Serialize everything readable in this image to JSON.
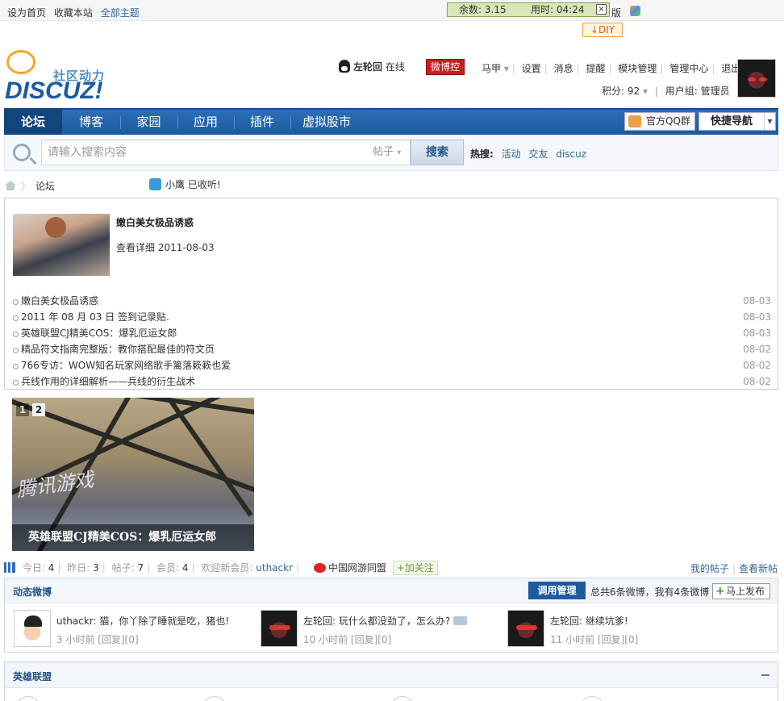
{
  "topbar": {
    "links": [
      "设为首页",
      "收藏本站",
      "全部主题"
    ],
    "remaining_label": "余数:",
    "remaining_value": "3.15",
    "time_label": "用时:",
    "time_value": "04:24",
    "close": "×",
    "version_text": "版"
  },
  "diy": {
    "label": "DIY",
    "arrow": "↓"
  },
  "logo": {
    "slogan": "社区动力",
    "word": "DISCUZ!"
  },
  "user": {
    "name": "左轮回",
    "status": "在线",
    "weibo_btn": "微博控",
    "menu": [
      "马甲",
      "设置",
      "消息",
      "提醒",
      "模块管理",
      "管理中心",
      "退出"
    ],
    "credits_label": "积分:",
    "credits_value": "92",
    "group_label": "用户组:",
    "group_value": "管理员"
  },
  "nav": {
    "tabs": [
      "论坛",
      "博客",
      "家园",
      "应用",
      "插件",
      "虚拟股市"
    ],
    "qqgroup": "官方QQ群",
    "quicknav": "快捷导航"
  },
  "search": {
    "placeholder": "请输入搜索内容",
    "type": "帖子",
    "button": "搜索",
    "hot_label": "热搜:",
    "hot_words": [
      "活动",
      "交友",
      "discuz"
    ]
  },
  "breadcrumb": {
    "current": "论坛"
  },
  "notice": {
    "text": "小鹰 已收听!"
  },
  "featured": {
    "title": "嫩白美女极品诱惑",
    "meta_link": "查看详细",
    "date": "2011-08-03"
  },
  "articles": [
    {
      "title": "嫩白美女极品诱惑",
      "date": "08-03"
    },
    {
      "title": "2011 年 08 月 03 日 签到记录贴.",
      "date": "08-03"
    },
    {
      "title": "英雄联盟CJ精美COS：爆乳厄运女郎",
      "date": "08-03"
    },
    {
      "title": "精品符文指南完整版：教你搭配最佳的符文页",
      "date": "08-02"
    },
    {
      "title": "766专访：WOW知名玩家网络歌手篱落簌簌也爱",
      "date": "08-02"
    },
    {
      "title": "兵线作用的详细解析——兵线的衍生战术",
      "date": "08-02"
    }
  ],
  "slideshow": {
    "pages": [
      "1",
      "2"
    ],
    "caption": "英雄联盟CJ精美COS：爆乳厄运女郎",
    "sign_text": "腾讯游戏"
  },
  "stats": {
    "today_label": "今日:",
    "today": "4",
    "yesterday_label": "昨日:",
    "yesterday": "3",
    "posts_label": "帖子:",
    "posts": "7",
    "members_label": "会员:",
    "members": "4",
    "welcome_label": "欢迎新会员:",
    "new_member": "uthackr",
    "alliance": "中国网游同盟",
    "follow": "+加关注",
    "my_posts": "我的帖子",
    "new_posts": "查看新帖"
  },
  "weibo": {
    "title": "动态微博",
    "manage": "调用管理",
    "summary": "总共6条微博，我有4条微博",
    "post": "马上发布",
    "items": [
      {
        "text": "uthackr: 猫，你丫除了睡就是吃，猪也!",
        "time": "3 小时前",
        "reply": "[回复][0]"
      },
      {
        "text": "左轮回: 玩什么都没劲了，怎么办?",
        "time": "10 小时前",
        "reply": "[回复][0]"
      },
      {
        "text": "左轮回: 继续坑爹!",
        "time": "11 小时前",
        "reply": "[回复][0]"
      }
    ]
  },
  "section2": {
    "title": "英雄联盟"
  },
  "colors": {
    "nav_blue": "#1d5a9e",
    "link_blue": "#336699",
    "weibo_red": "#c81e1e"
  }
}
